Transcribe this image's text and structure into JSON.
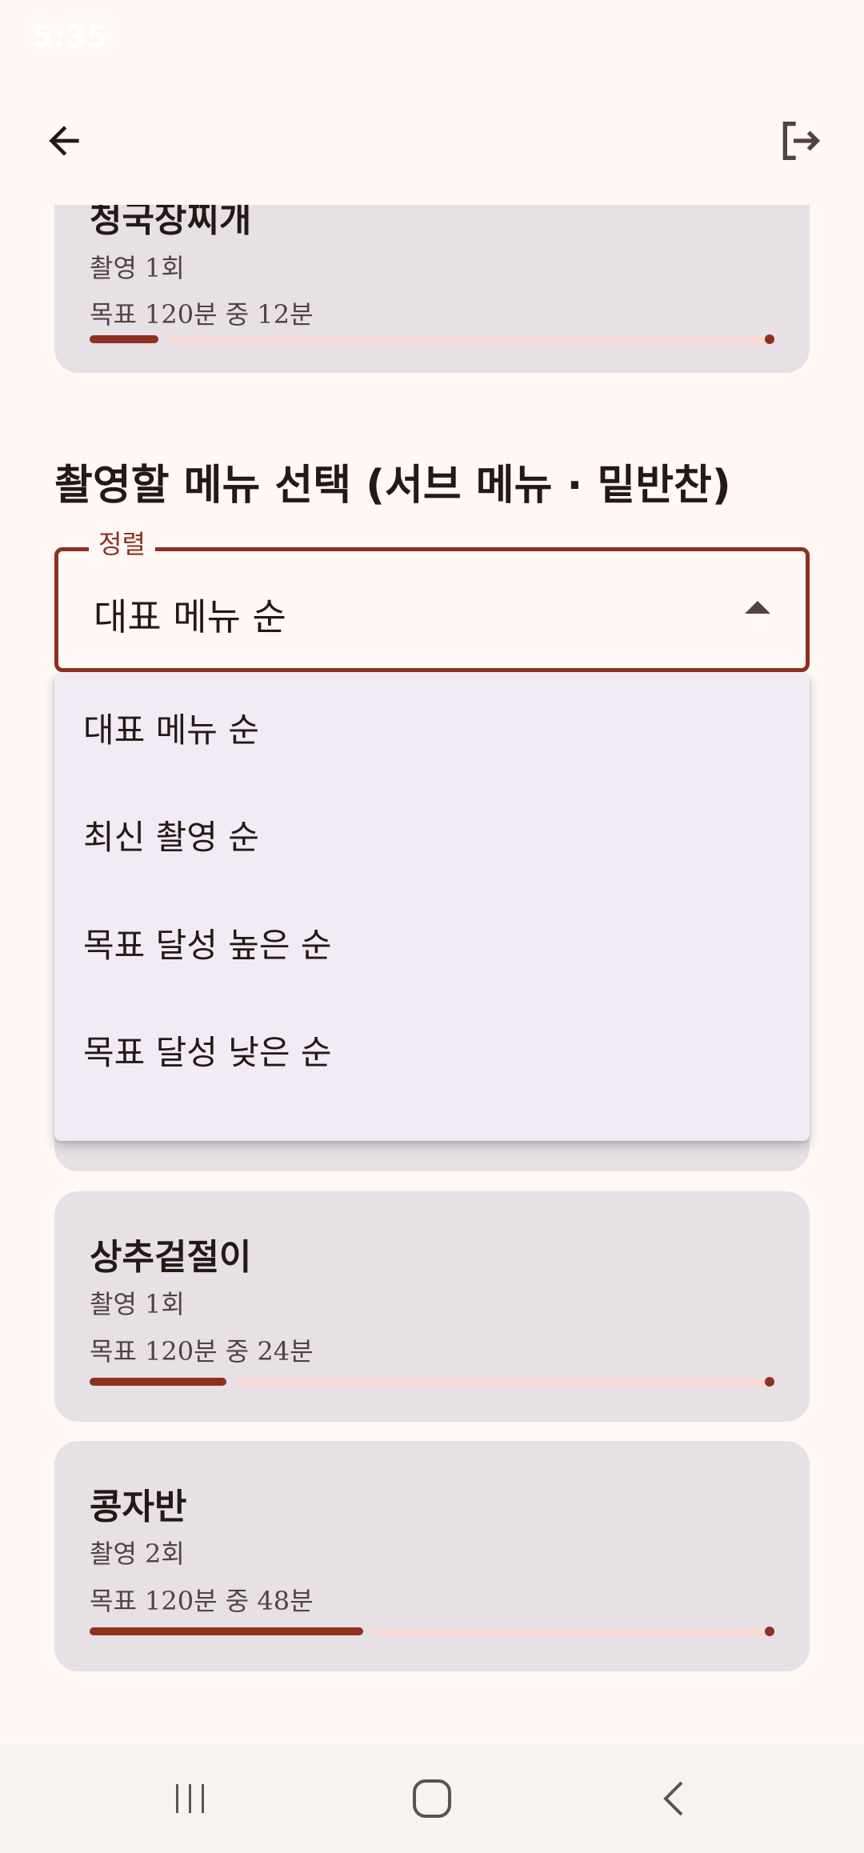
{
  "status_bar": {
    "time": "5:35"
  },
  "top_bar": {
    "back_icon": "arrow-back-icon",
    "logout_icon": "logout-icon"
  },
  "cards": [
    {
      "title": "청국장찌개",
      "shots": "촬영 1회",
      "goal": "목표 120분 중 12분",
      "progress": 0.1
    },
    {
      "title": "상추겉절이",
      "shots": "촬영 1회",
      "goal": "목표 120분 중 24분",
      "progress": 0.2
    },
    {
      "title": "콩자반",
      "shots": "촬영 2회",
      "goal": "목표 120분 중 48분",
      "progress": 0.4
    }
  ],
  "section": {
    "title": "촬영할 메뉴 선택 (서브 메뉴 · 밑반찬)"
  },
  "sort": {
    "label": "정렬",
    "selected": "대표 메뉴 순",
    "options": [
      "대표 메뉴 순",
      "최신 촬영 순",
      "목표 달성 높은 순",
      "목표 달성 낮은 순"
    ]
  },
  "nav": {
    "recents_icon": "recents-icon",
    "home_icon": "home-icon",
    "back_icon": "back-chevron-icon"
  },
  "colors": {
    "accent": "#8E3120",
    "track": "#FADAD3",
    "card": "#E7E0E5",
    "background": "#FFF8F5",
    "menu": "#F2EAF4"
  }
}
